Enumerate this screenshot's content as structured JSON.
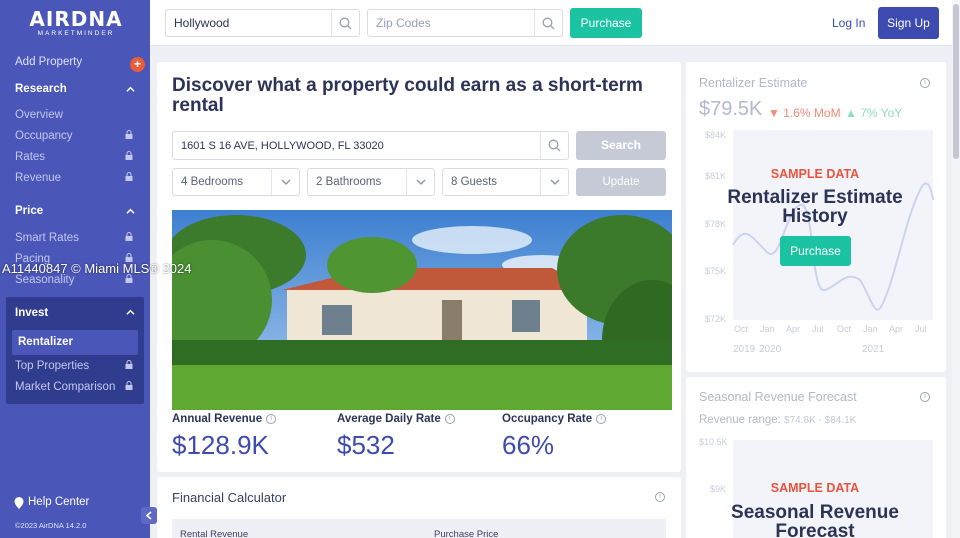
{
  "brand": {
    "name": "AIRDNA",
    "tagline": "MARKETMINDER"
  },
  "sidebar": {
    "add_property": "Add Property",
    "add_badge": "+",
    "research": {
      "label": "Research",
      "items": [
        "Overview",
        "Occupancy",
        "Rates",
        "Revenue"
      ]
    },
    "price": {
      "label": "Price",
      "items": [
        "Smart Rates",
        "Pacing",
        "Seasonality"
      ]
    },
    "invest": {
      "label": "Invest",
      "items": [
        "Rentalizer",
        "Top Properties",
        "Market Comparison"
      ]
    },
    "help": "Help Center",
    "copyright": "©2023 AirDNA 14.2.0"
  },
  "topbar": {
    "location_value": "Hollywood",
    "zip_placeholder": "Zip Codes",
    "purchase": "Purchase",
    "login": "Log In",
    "signup": "Sign Up"
  },
  "main": {
    "title": "Discover what a property could earn as a short-term rental",
    "address_value": "1601 S 16 AVE, HOLLYWOOD, FL 33020",
    "search": "Search",
    "bedrooms": "4 Bedrooms",
    "bathrooms": "2 Bathrooms",
    "guests": "8 Guests",
    "update": "Update",
    "watermark": "A11440847 © Miami MLS® 2024",
    "metrics": [
      {
        "label": "Annual Revenue",
        "value": "$128.9K"
      },
      {
        "label": "Average Daily Rate",
        "value": "$532"
      },
      {
        "label": "Occupancy Rate",
        "value": "66%"
      }
    ],
    "financial": {
      "title": "Financial Calculator",
      "col1": "Rental Revenue",
      "col2": "Purchase Price"
    }
  },
  "estimate": {
    "title": "Rentalizer Estimate",
    "value": "$79.5K",
    "mom": "1.6% MoM",
    "yoy": "7% YoY",
    "sample": "SAMPLE DATA",
    "overlay_title": "Rentalizer Estimate History",
    "purchase": "Purchase",
    "y_ticks": [
      "$84K",
      "$81K",
      "$78K",
      "$75K",
      "$72K"
    ],
    "x_ticks": [
      "Oct",
      "Jan",
      "Apr",
      "Jul",
      "Oct",
      "Jan",
      "Apr",
      "Jul"
    ],
    "years": [
      "2019",
      "2020",
      "2021"
    ]
  },
  "seasonal": {
    "title": "Seasonal Revenue Forecast",
    "range_label": "Revenue range:",
    "range_value": "$74.8K - $84.1K",
    "y_ticks": [
      "$10.5K",
      "$9K"
    ],
    "sample": "SAMPLE DATA",
    "overlay_title": "Seasonal Revenue Forecast"
  },
  "colors": {
    "sidebar": "#4a56b8",
    "accent_green": "#1cc3a2",
    "primary": "#3d4ab0",
    "down_red": "#ea5b3a"
  }
}
